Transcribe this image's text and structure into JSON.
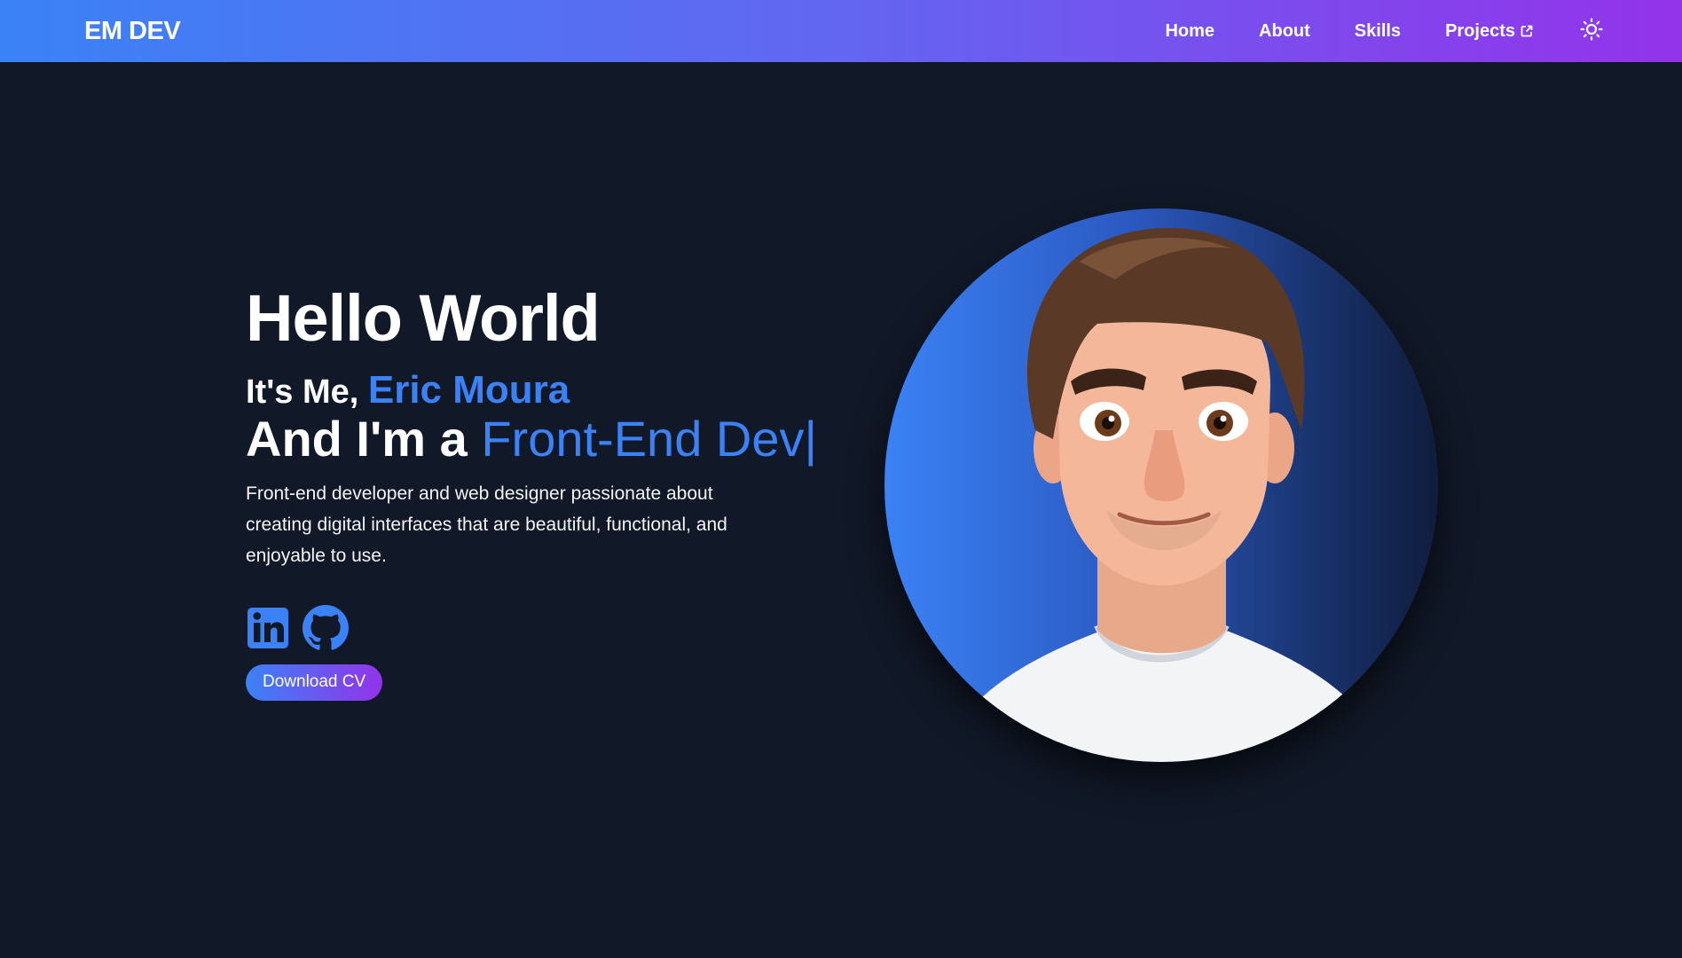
{
  "brand": "EM DEV",
  "nav": {
    "home": "Home",
    "about": "About",
    "skills": "Skills",
    "projects": "Projects"
  },
  "hero": {
    "greeting": "Hello World",
    "intro_prefix": "It's Me, ",
    "name": "Eric Moura",
    "role_prefix": "And I'm a ",
    "role": "Front-End Dev",
    "cursor": "|",
    "description": "Front-end developer and web designer passionate about creating digital interfaces that are beautiful, functional, and enjoyable to use.",
    "cv_button": "Download CV"
  },
  "icons": {
    "external_link": "external-link-icon",
    "theme": "sun-icon",
    "linkedin": "linkedin-icon",
    "github": "github-icon"
  },
  "colors": {
    "background": "#111827",
    "accent": "#3b82f6",
    "gradient_start": "#3b82f6",
    "gradient_end": "#9333ea"
  }
}
